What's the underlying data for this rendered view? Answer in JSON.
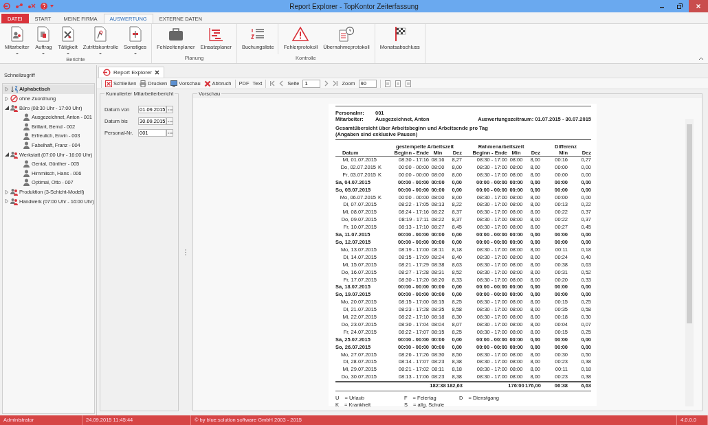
{
  "window": {
    "title": "Report Explorer - TopKontor Zeiterfassung"
  },
  "ribbon": {
    "tabs": [
      {
        "label": "DATEI",
        "kind": "file",
        "selected": false
      },
      {
        "label": "START",
        "kind": "tab",
        "selected": false
      },
      {
        "label": "MEINE FIRMA",
        "kind": "tab",
        "selected": false
      },
      {
        "label": "AUSWERTUNG",
        "kind": "tab",
        "selected": true
      },
      {
        "label": "EXTERNE DATEN",
        "kind": "tab",
        "selected": false
      }
    ],
    "groups": [
      {
        "label": "Berichte",
        "buttons": [
          {
            "label": "Mitarbeiter",
            "dropdown": true
          },
          {
            "label": "Auftrag",
            "dropdown": true
          },
          {
            "label": "Tätigkeit",
            "dropdown": true
          },
          {
            "label": "Zutrittskontrolle",
            "dropdown": true
          },
          {
            "label": "Sonstiges",
            "dropdown": true
          }
        ]
      },
      {
        "label": "Planung",
        "buttons": [
          {
            "label": "Fehlzeitenplaner",
            "dropdown": false
          },
          {
            "label": "Einsatzplaner",
            "dropdown": false
          }
        ]
      },
      {
        "label": "Kontrolle",
        "buttons": [
          {
            "label": "Buchungsliste",
            "dropdown": false,
            "divider_before": false
          },
          {
            "label": "Fehlerprotokoll",
            "dropdown": false,
            "divider_before": true
          },
          {
            "label": "Übernahmeprotokoll",
            "dropdown": false,
            "divider_before": false
          }
        ]
      },
      {
        "buttons": [
          {
            "label": "Monatsabschluss",
            "dropdown": false
          }
        ]
      }
    ]
  },
  "quick_access": {
    "title": "Schnellzugriff",
    "tree": [
      {
        "label": "Alphabetisch",
        "kind": "sort",
        "expanded": false,
        "selected": true
      },
      {
        "label": "ohne Zuordnung",
        "kind": "unassigned",
        "expanded": false,
        "selected": false
      },
      {
        "label": "Büro (08:30 Uhr - 17:00 Uhr)",
        "kind": "group",
        "expanded": true,
        "selected": false,
        "children": [
          {
            "label": "Ausgezeichnet, Anton - 001",
            "kind": "person",
            "selected": false
          },
          {
            "label": "Brillant, Bernd - 002",
            "kind": "person",
            "selected": false
          },
          {
            "label": "Erfreulich, Erwin - 003",
            "kind": "person",
            "selected": false
          },
          {
            "label": "Fabelhaft, Franz - 004",
            "kind": "person",
            "selected": false
          }
        ]
      },
      {
        "label": "Werkstatt (07:00 Uhr - 16:00 Uhr)",
        "kind": "group",
        "expanded": true,
        "selected": false,
        "children": [
          {
            "label": "Genial, Günther - 005",
            "kind": "person",
            "selected": false
          },
          {
            "label": "Himmlisch, Hans - 006",
            "kind": "person",
            "selected": false
          },
          {
            "label": "Optimal, Otto - 007",
            "kind": "person",
            "selected": false
          }
        ]
      },
      {
        "label": "Produktion (3-Schicht-Modell)",
        "kind": "group",
        "expanded": false,
        "selected": false
      },
      {
        "label": "Handwerk (07:00 Uhr - 16:00 Uhr)",
        "kind": "group",
        "expanded": false,
        "selected": false
      }
    ]
  },
  "document_tab": {
    "label": "Report Explorer"
  },
  "toolbar": {
    "buttons": [
      {
        "label": "Schließen"
      },
      {
        "label": "Drucken"
      },
      {
        "label": "Vorschau"
      },
      {
        "label": "Abbruch"
      }
    ],
    "exports": [
      "PDF",
      "Text"
    ],
    "page_label": "Seite",
    "page": "1",
    "zoom_label": "Zoom",
    "zoom": "90"
  },
  "form": {
    "title": "Kumulierter Mitarbeiterbericht",
    "fields": [
      {
        "label": "Datum von",
        "value": "01.09.2015"
      },
      {
        "label": "Datum bis",
        "value": "30.09.2015"
      },
      {
        "label": "Personal-Nr.",
        "value": "001"
      }
    ]
  },
  "preview": {
    "title": "Vorschau",
    "report": {
      "personnel_label": "Personalnr:",
      "personnel": "001",
      "employee_label": "Mitarbeiter:",
      "employee": "Ausgezeichnet, Anton",
      "period": "Auswertungszeitraum: 01.07.2015 - 30.07.2015",
      "subtitle": "Gesamtübersicht über Arbeitsbeginn und Arbeitsende pro Tag",
      "note": "(Angaben sind exklusive Pausen)",
      "group_headers": [
        "gestempelte Arbeitszeit",
        "Rahmenarbeitszeit",
        "Differenz"
      ],
      "columns": [
        "Datum",
        "Beginn  - Ende",
        "Min",
        "Dez",
        "Beginn  - Ende",
        "Min",
        "Dez",
        "Min",
        "Dez"
      ],
      "rows": [
        {
          "cells": [
            "Mi, 01.07.2015",
            "08:30 - 17:16",
            "08:16",
            "8,27",
            "08:30 - 17:00",
            "08:00",
            "8,00",
            "00:16",
            "0,27"
          ],
          "weekend": false
        },
        {
          "cells": [
            "Do, 02.07.2015",
            "00:00 - 00:00",
            "08:00",
            "8,00",
            "08:30 - 17:00",
            "08:00",
            "8,00",
            "00:00",
            "0,00"
          ],
          "code": "K",
          "weekend": false
        },
        {
          "cells": [
            "Fr, 03.07.2015",
            "00:00 - 00:00",
            "08:00",
            "8,00",
            "08:30 - 17:00",
            "08:00",
            "8,00",
            "00:00",
            "0,00"
          ],
          "code": "K",
          "weekend": false
        },
        {
          "cells": [
            "Sa, 04.07.2015",
            "00:00 - 00:00",
            "00:00",
            "0,00",
            "00:00 - 00:00",
            "00:00",
            "0,00",
            "00:00",
            "0,00"
          ],
          "weekend": true
        },
        {
          "cells": [
            "So, 05.07.2015",
            "00:00 - 00:00",
            "00:00",
            "0,00",
            "00:00 - 00:00",
            "00:00",
            "0,00",
            "00:00",
            "0,00"
          ],
          "weekend": true
        },
        {
          "cells": [
            "Mo, 06.07.2015",
            "00:00 - 00:00",
            "08:00",
            "8,00",
            "08:30 - 17:00",
            "08:00",
            "8,00",
            "00:00",
            "0,00"
          ],
          "code": "K",
          "weekend": false
        },
        {
          "cells": [
            "Di, 07.07.2015",
            "08:22 - 17:05",
            "08:13",
            "8,22",
            "08:30 - 17:00",
            "08:00",
            "8,00",
            "00:13",
            "0,22"
          ],
          "weekend": false
        },
        {
          "cells": [
            "Mi, 08.07.2015",
            "08:24 - 17:16",
            "08:22",
            "8,37",
            "08:30 - 17:00",
            "08:00",
            "8,00",
            "00:22",
            "0,37"
          ],
          "weekend": false
        },
        {
          "cells": [
            "Do, 09.07.2015",
            "08:19 - 17:11",
            "08:22",
            "8,37",
            "08:30 - 17:00",
            "08:00",
            "8,00",
            "00:22",
            "0,37"
          ],
          "weekend": false
        },
        {
          "cells": [
            "Fr, 10.07.2015",
            "08:13 - 17:10",
            "08:27",
            "8,45",
            "08:30 - 17:00",
            "08:00",
            "8,00",
            "00:27",
            "0,45"
          ],
          "weekend": false
        },
        {
          "cells": [
            "Sa, 11.07.2015",
            "00:00 - 00:00",
            "00:00",
            "0,00",
            "00:00 - 00:00",
            "00:00",
            "0,00",
            "00:00",
            "0,00"
          ],
          "weekend": true
        },
        {
          "cells": [
            "So, 12.07.2015",
            "00:00 - 00:00",
            "00:00",
            "0,00",
            "00:00 - 00:00",
            "00:00",
            "0,00",
            "00:00",
            "0,00"
          ],
          "weekend": true
        },
        {
          "cells": [
            "Mo, 13.07.2015",
            "08:19 - 17:00",
            "08:11",
            "8,18",
            "08:30 - 17:00",
            "08:00",
            "8,00",
            "00:11",
            "0,18"
          ],
          "weekend": false
        },
        {
          "cells": [
            "Di, 14.07.2015",
            "08:15 - 17:09",
            "08:24",
            "8,40",
            "08:30 - 17:00",
            "08:00",
            "8,00",
            "00:24",
            "0,40"
          ],
          "weekend": false
        },
        {
          "cells": [
            "Mi, 15.07.2015",
            "08:21 - 17:29",
            "08:38",
            "8,63",
            "08:30 - 17:00",
            "08:00",
            "8,00",
            "00:38",
            "0,63"
          ],
          "weekend": false
        },
        {
          "cells": [
            "Do, 16.07.2015",
            "08:27 - 17:28",
            "08:31",
            "8,52",
            "08:30 - 17:00",
            "08:00",
            "8,00",
            "00:31",
            "0,52"
          ],
          "weekend": false
        },
        {
          "cells": [
            "Fr, 17.07.2015",
            "08:30 - 17:20",
            "08:20",
            "8,33",
            "08:30 - 17:00",
            "08:00",
            "8,00",
            "00:20",
            "0,33"
          ],
          "weekend": false
        },
        {
          "cells": [
            "Sa, 18.07.2015",
            "00:00 - 00:00",
            "00:00",
            "0,00",
            "00:00 - 00:00",
            "00:00",
            "0,00",
            "00:00",
            "0,00"
          ],
          "weekend": true
        },
        {
          "cells": [
            "So, 19.07.2015",
            "00:00 - 00:00",
            "00:00",
            "0,00",
            "00:00 - 00:00",
            "00:00",
            "0,00",
            "00:00",
            "0,00"
          ],
          "weekend": true
        },
        {
          "cells": [
            "Mo, 20.07.2015",
            "08:15 - 17:00",
            "08:15",
            "8,25",
            "08:30 - 17:00",
            "08:00",
            "8,00",
            "00:15",
            "0,25"
          ],
          "weekend": false
        },
        {
          "cells": [
            "Di, 21.07.2015",
            "08:23 - 17:28",
            "08:35",
            "8,58",
            "08:30 - 17:00",
            "08:00",
            "8,00",
            "00:35",
            "0,58"
          ],
          "weekend": false
        },
        {
          "cells": [
            "Mi, 22.07.2015",
            "08:22 - 17:10",
            "08:18",
            "8,30",
            "08:30 - 17:00",
            "08:00",
            "8,00",
            "00:18",
            "0,30"
          ],
          "weekend": false
        },
        {
          "cells": [
            "Do, 23.07.2015",
            "08:30 - 17:04",
            "08:04",
            "8,07",
            "08:30 - 17:00",
            "08:00",
            "8,00",
            "00:04",
            "0,07"
          ],
          "weekend": false
        },
        {
          "cells": [
            "Fr, 24.07.2015",
            "08:22 - 17:07",
            "08:15",
            "8,25",
            "08:30 - 17:00",
            "08:00",
            "8,00",
            "00:15",
            "0,25"
          ],
          "weekend": false
        },
        {
          "cells": [
            "Sa, 25.07.2015",
            "00:00 - 00:00",
            "00:00",
            "0,00",
            "00:00 - 00:00",
            "00:00",
            "0,00",
            "00:00",
            "0,00"
          ],
          "weekend": true
        },
        {
          "cells": [
            "So, 26.07.2015",
            "00:00 - 00:00",
            "00:00",
            "0,00",
            "00:00 - 00:00",
            "00:00",
            "0,00",
            "00:00",
            "0,00"
          ],
          "weekend": true
        },
        {
          "cells": [
            "Mo, 27.07.2015",
            "08:26 - 17:26",
            "08:30",
            "8,50",
            "08:30 - 17:00",
            "08:00",
            "8,00",
            "00:30",
            "0,50"
          ],
          "weekend": false
        },
        {
          "cells": [
            "Di, 28.07.2015",
            "08:14 - 17:07",
            "08:23",
            "8,38",
            "08:30 - 17:00",
            "08:00",
            "8,00",
            "00:23",
            "0,38"
          ],
          "weekend": false
        },
        {
          "cells": [
            "Mi, 29.07.2015",
            "08:21 - 17:02",
            "08:11",
            "8,18",
            "08:30 - 17:00",
            "08:00",
            "8,00",
            "00:11",
            "0,18"
          ],
          "weekend": false
        },
        {
          "cells": [
            "Do, 30.07.2015",
            "08:13 - 17:06",
            "08:23",
            "8,38",
            "08:30 - 17:00",
            "08:00",
            "8,00",
            "00:23",
            "0,38"
          ],
          "weekend": false
        }
      ],
      "totals": [
        "182:38",
        "182,63",
        "176:00",
        "176,00",
        "06:38",
        "6,63"
      ],
      "legend": [
        {
          "code": "U",
          "text": "= Urlaub"
        },
        {
          "code": "F",
          "text": "= Feiertag"
        },
        {
          "code": "D",
          "text": "= Dienstgang"
        },
        {
          "code": "K",
          "text": "= Krankheit"
        },
        {
          "code": "S",
          "text": "= allg. Schule"
        }
      ]
    }
  },
  "status_bar": [
    "Administrator",
    "24.09.2015 11:45:44",
    "© by blue:solution software GmbH 2003 - 2015",
    "4.0.0.0"
  ]
}
